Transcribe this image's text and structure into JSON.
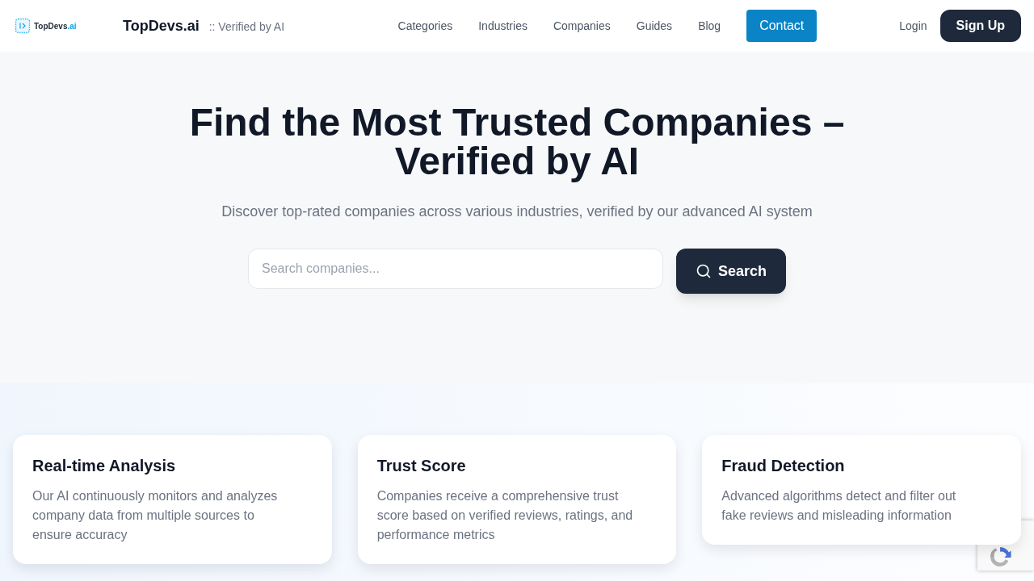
{
  "header": {
    "logo": {
      "name": "TopDevs",
      "suffix": ".ai"
    },
    "brand": "TopDevs.ai",
    "tagline": ":: Verified by AI",
    "nav": [
      {
        "label": "Categories"
      },
      {
        "label": "Industries"
      },
      {
        "label": "Companies"
      },
      {
        "label": "Guides"
      },
      {
        "label": "Blog"
      }
    ],
    "contact": "Contact",
    "login": "Login",
    "signup": "Sign Up"
  },
  "hero": {
    "title": "Find the Most Trusted Companies – Verified by AI",
    "subtitle": "Discover top-rated companies across various industries, verified by our advanced AI system",
    "search": {
      "placeholder": "Search companies...",
      "button": "Search"
    }
  },
  "features": [
    {
      "title": "Real-time Analysis",
      "description": "Our AI continuously monitors and analyzes company data from multiple sources to ensure accuracy"
    },
    {
      "title": "Trust Score",
      "description": "Companies receive a comprehensive trust score based on verified reviews, ratings, and performance metrics"
    },
    {
      "title": "Fraud Detection",
      "description": "Advanced algorithms detect and filter out fake reviews and misleading information"
    }
  ]
}
